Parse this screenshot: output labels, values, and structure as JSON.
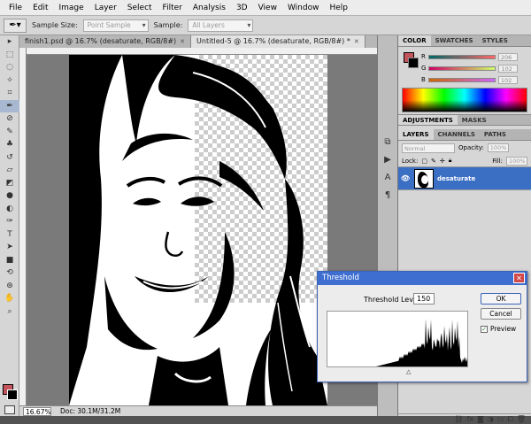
{
  "menu": [
    "File",
    "Edit",
    "Image",
    "Layer",
    "Select",
    "Filter",
    "Analysis",
    "3D",
    "View",
    "Window",
    "Help"
  ],
  "options": {
    "sample_size_label": "Sample Size:",
    "sample_size_value": "Point Sample",
    "sample_label": "Sample:",
    "sample_value": "All Layers"
  },
  "documents": [
    {
      "title": "finish1.psd @ 16.7% (desaturate, RGB/8#)",
      "active": false
    },
    {
      "title": "Untitled-5 @ 16.7% (desaturate, RGB/8#) *",
      "active": true
    }
  ],
  "status": {
    "zoom": "16.67%",
    "doc_info": "Doc: 30.1M/31.2M"
  },
  "color_panel": {
    "tabs": [
      "COLOR",
      "SWATCHES",
      "STYLES"
    ],
    "fg_color": "#c4545c",
    "channels": [
      {
        "label": "R",
        "value": "206"
      },
      {
        "label": "G",
        "value": "102"
      },
      {
        "label": "B",
        "value": "102"
      }
    ]
  },
  "adjust_tabs": [
    "ADJUSTMENTS",
    "MASKS"
  ],
  "layers_panel": {
    "tabs": [
      "LAYERS",
      "CHANNELS",
      "PATHS"
    ],
    "blend_mode": "Normal",
    "opacity_label": "Opacity:",
    "opacity_value": "100%",
    "lock_label": "Lock:",
    "fill_label": "Fill:",
    "fill_value": "100%",
    "layer_name": "desaturate"
  },
  "dialog": {
    "title": "Threshold",
    "level_label": "Threshold Level:",
    "level_value": "150",
    "ok_label": "OK",
    "cancel_label": "Cancel",
    "preview_label": "Preview"
  }
}
